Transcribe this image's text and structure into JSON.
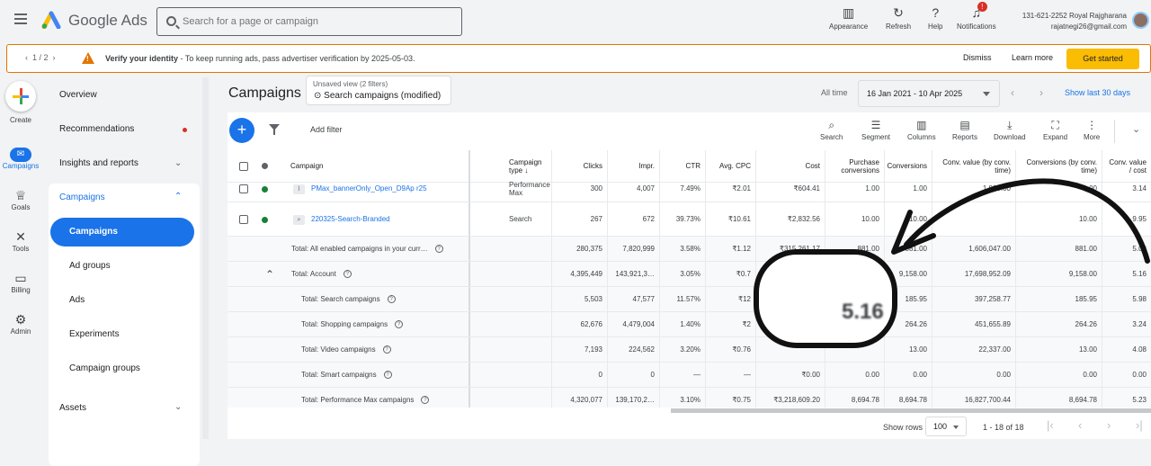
{
  "topbar": {
    "brand": "Google Ads",
    "search_placeholder": "Search for a page or campaign",
    "tools": [
      "Appearance",
      "Refresh",
      "Help",
      "Notifications"
    ],
    "notif_count": "!",
    "account_id": "131-621-2252 Royal Rajgharana",
    "account_email": "rajatnegi26@gmail.com"
  },
  "banner": {
    "pager": "1 / 2",
    "title": "Verify your identity",
    "text": " - To keep running ads, pass advertiser verification by 2025-05-03.",
    "dismiss": "Dismiss",
    "learn": "Learn more",
    "cta": "Get started"
  },
  "rail": {
    "create": "Create",
    "campaigns": "Campaigns",
    "goals": "Goals",
    "tools": "Tools",
    "billing": "Billing",
    "admin": "Admin"
  },
  "nav": {
    "overview": "Overview",
    "recommendations": "Recommendations",
    "insights": "Insights and reports",
    "campaigns_section": "Campaigns",
    "campaigns": "Campaigns",
    "ad_groups": "Ad groups",
    "ads": "Ads",
    "experiments": "Experiments",
    "campaign_groups": "Campaign groups",
    "assets": "Assets"
  },
  "header": {
    "title": "Campaigns",
    "view_label": "Unsaved view (2 filters)",
    "view_name": "Search campaigns (modified)",
    "all_time": "All time",
    "date_range": "16 Jan 2021 - 10 Apr 2025",
    "last30": "Show last 30 days"
  },
  "toolbar": {
    "add_filter": "Add filter",
    "items": [
      "Search",
      "Segment",
      "Columns",
      "Reports",
      "Download",
      "Expand",
      "More"
    ]
  },
  "table": {
    "headers": [
      "Campaign",
      "Campaign type",
      "Clicks",
      "Impr.",
      "CTR",
      "Avg. CPC",
      "Cost",
      "Purchase conversions",
      "Conversions",
      "Conv. value (by conv. time)",
      "Conversions (by conv. time)",
      "Conv. value / cost"
    ],
    "campaigns": [
      {
        "name": "PMax_bannerOnly_Open_D9Ap r25",
        "type": "Performance Max",
        "cells": [
          "300",
          "4,007",
          "7.49%",
          "₹2.01",
          "₹604.41",
          "1.00",
          "1.00",
          "1,899.00",
          "1.00",
          "3.14"
        ]
      },
      {
        "name": "220325-Search-Branded",
        "type": "Search",
        "cells": [
          "267",
          "672",
          "39.73%",
          "₹10.61",
          "₹2,832.56",
          "10.00",
          "10.00",
          "",
          "10.00",
          "9.95"
        ]
      }
    ],
    "totals": [
      {
        "label": "Total: All enabled campaigns in your curr…",
        "cells": [
          "280,375",
          "7,820,999",
          "3.58%",
          "₹1.12",
          "₹315,261.17",
          "881.00",
          "881.00",
          "1,606,047.00",
          "881.00",
          "5.09"
        ]
      },
      {
        "label": "Total: Account",
        "cells": [
          "4,395,449",
          "143,921,3…",
          "3.05%",
          "₹0.7",
          "",
          "",
          "9,158.00",
          "17,698,952.09",
          "9,158.00",
          "5.16"
        ]
      },
      {
        "label": "Total: Search campaigns",
        "cells": [
          "5,503",
          "47,577",
          "11.57%",
          "₹12",
          "",
          "",
          "185.95",
          "397,258.77",
          "185.95",
          "5.98"
        ]
      },
      {
        "label": "Total: Shopping campaigns",
        "cells": [
          "62,676",
          "4,479,004",
          "1.40%",
          "₹2",
          "",
          "",
          "264.26",
          "451,655.89",
          "264.26",
          "3.24"
        ]
      },
      {
        "label": "Total: Video campaigns",
        "cells": [
          "7,193",
          "224,562",
          "3.20%",
          "₹0.76",
          "",
          "",
          "13.00",
          "22,337.00",
          "13.00",
          "4.08"
        ]
      },
      {
        "label": "Total: Smart campaigns",
        "cells": [
          "0",
          "0",
          "—",
          "—",
          "₹0.00",
          "0.00",
          "0.00",
          "0.00",
          "0.00",
          "0.00"
        ]
      },
      {
        "label": "Total: Performance Max campaigns",
        "cells": [
          "4,320,077",
          "139,170,2…",
          "3.10%",
          "₹0.75",
          "₹3,218,609.20",
          "8,694.78",
          "8,694.78",
          "16,827,700.44",
          "8,694.78",
          "5.23"
        ]
      }
    ]
  },
  "footer": {
    "show_rows": "Show rows",
    "rows": "100",
    "range": "1 - 18 of 18"
  },
  "annotation": {
    "zoom_value": "5.16"
  }
}
